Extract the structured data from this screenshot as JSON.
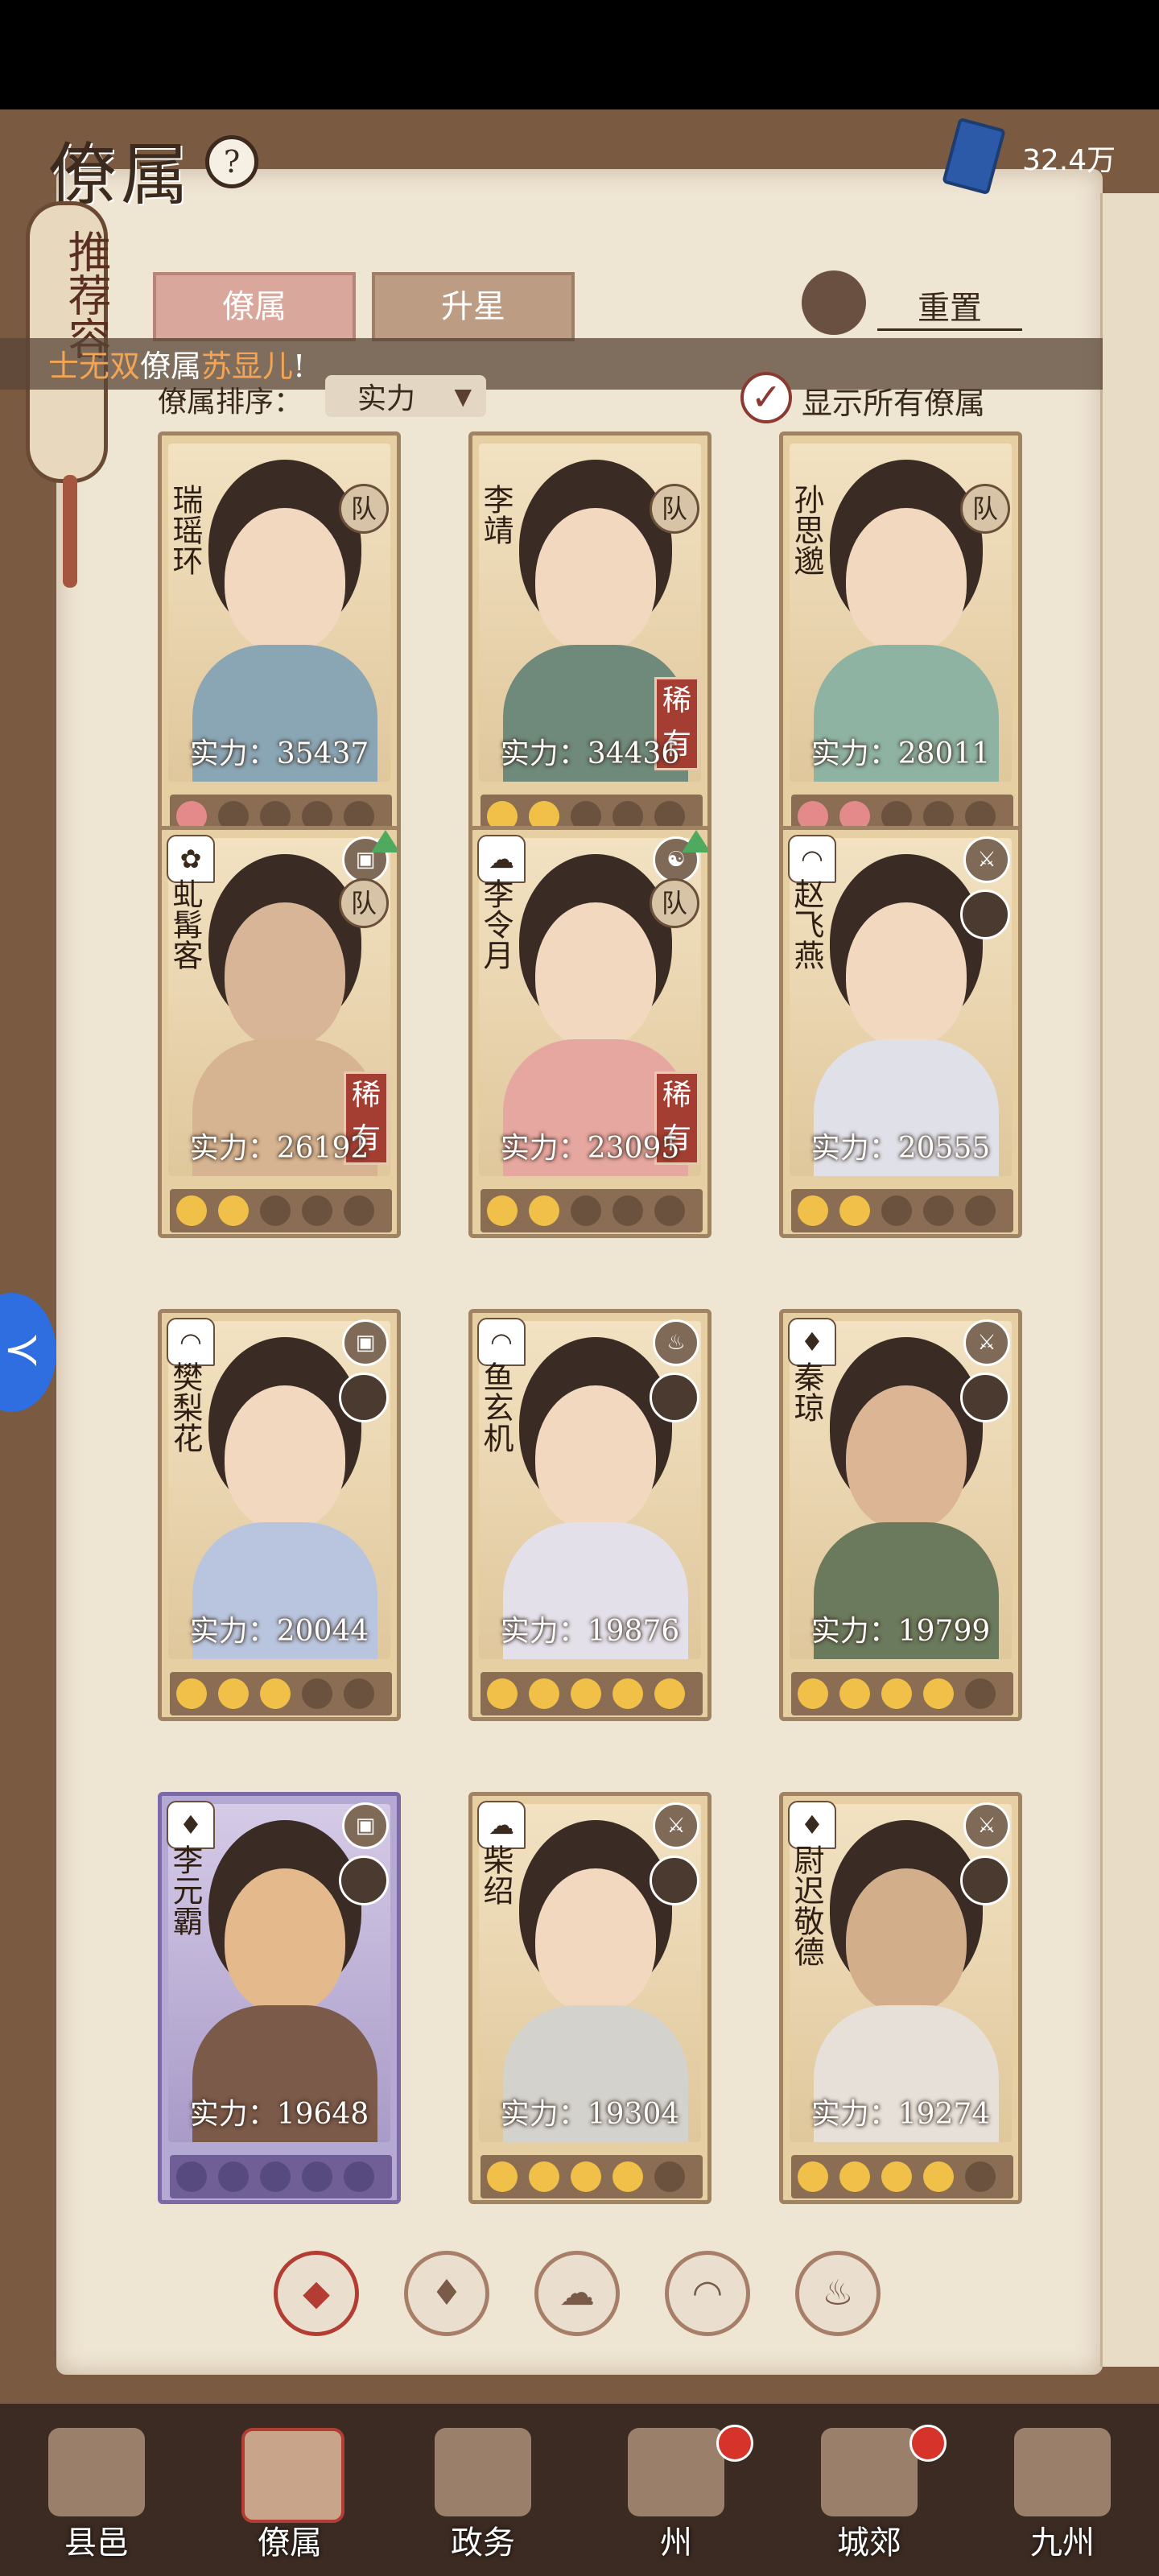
{
  "header": {
    "title": "僚属",
    "currency_value": "32.4万"
  },
  "recommend_label": "推荐容",
  "tabs": [
    {
      "label": "僚属"
    },
    {
      "label": "升星"
    }
  ],
  "reset_label": "重置",
  "ticker": {
    "prefix": "士无双",
    "middle": "僚属",
    "name": "苏显儿",
    "suffix": "!"
  },
  "sort": {
    "label": "僚属排序：",
    "value": "实力"
  },
  "show_all_label": "显示所有僚属",
  "cards": [
    {
      "name": "瑞瑶环",
      "power": "实力：35437",
      "team": "队",
      "rare": "",
      "stars": [
        "pink",
        "off",
        "off",
        "off",
        "off"
      ]
    },
    {
      "name": "李靖",
      "power": "实力：34436",
      "team": "队",
      "rare": "稀有",
      "stars": [
        "gold",
        "gold",
        "off",
        "off",
        "off"
      ]
    },
    {
      "name": "孙思邈",
      "power": "实力：28011",
      "team": "队",
      "rare": "",
      "stars": [
        "pink",
        "pink",
        "off",
        "off",
        "off"
      ]
    },
    {
      "name": "虬髯客",
      "power": "实力：26192",
      "team": "队",
      "rare": "稀有",
      "stars": [
        "gold",
        "gold",
        "off",
        "off",
        "off"
      ]
    },
    {
      "name": "李令月",
      "power": "实力：23095",
      "team": "队",
      "rare": "稀有",
      "stars": [
        "gold",
        "gold",
        "off",
        "off",
        "off"
      ]
    },
    {
      "name": "赵飞燕",
      "power": "实力：20555",
      "team": "",
      "rare": "",
      "stars": [
        "gold",
        "gold",
        "off",
        "off",
        "off"
      ]
    },
    {
      "name": "樊梨花",
      "power": "实力：20044",
      "team": "",
      "rare": "",
      "stars": [
        "gold",
        "gold",
        "gold",
        "off",
        "off"
      ]
    },
    {
      "name": "鱼玄机",
      "power": "实力：19876",
      "team": "",
      "rare": "",
      "stars": [
        "gold",
        "gold",
        "gold",
        "gold",
        "gold"
      ]
    },
    {
      "name": "秦琼",
      "power": "实力：19799",
      "team": "",
      "rare": "",
      "stars": [
        "gold",
        "gold",
        "gold",
        "gold",
        "off"
      ]
    },
    {
      "name": "李元霸",
      "power": "实力：19648",
      "team": "",
      "rare": "",
      "stars": [
        "gold",
        "gold",
        "off",
        "off",
        "off"
      ]
    },
    {
      "name": "柴绍",
      "power": "实力：19304",
      "team": "",
      "rare": "",
      "stars": [
        "gold",
        "gold",
        "gold",
        "gold",
        "off"
      ]
    },
    {
      "name": "尉迟敬德",
      "power": "实力：19274",
      "team": "",
      "rare": "",
      "stars": [
        "gold",
        "gold",
        "gold",
        "gold",
        "off"
      ]
    }
  ],
  "bottom_nav": [
    {
      "label": "县邑"
    },
    {
      "label": "僚属"
    },
    {
      "label": "政务"
    },
    {
      "label": "州"
    },
    {
      "label": "城郊"
    },
    {
      "label": "九州"
    }
  ],
  "colors": {
    "accent_red": "#b33d32",
    "gold_star": "#f0c048",
    "pink_star": "#e58a8a",
    "purple_card": "#b3a9d2"
  },
  "icons": [
    "help-icon",
    "currency-book-icon",
    "reset-icon",
    "check-icon",
    "class-icon",
    "weapon-icon",
    "up-arrow-icon",
    "filter-all-icon",
    "filter-bell-icon",
    "filter-cat-icon",
    "filter-fan-icon",
    "filter-lion-icon"
  ]
}
